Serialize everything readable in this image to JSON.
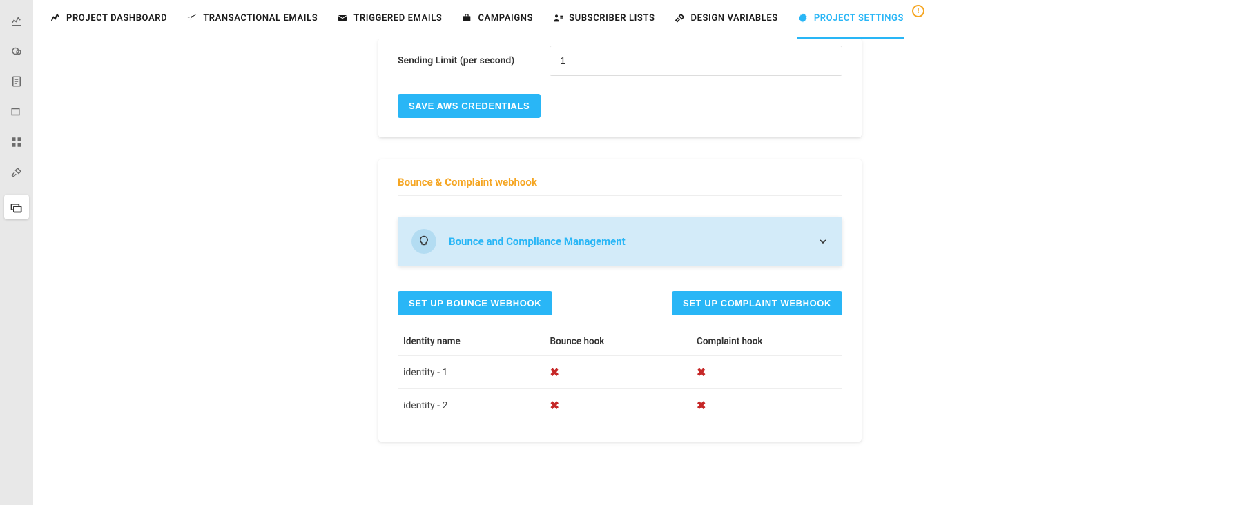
{
  "sidebar": {
    "items": [
      {
        "name": "analytics"
      },
      {
        "name": "cloud"
      },
      {
        "name": "document"
      },
      {
        "name": "layout"
      },
      {
        "name": "grid"
      },
      {
        "name": "tools"
      },
      {
        "name": "folders",
        "active": true
      }
    ]
  },
  "tabs": [
    {
      "label": "PROJECT DASHBOARD",
      "icon": "chart"
    },
    {
      "label": "TRANSACTIONAL EMAILS",
      "icon": "send"
    },
    {
      "label": "TRIGGERED EMAILS",
      "icon": "mail"
    },
    {
      "label": "CAMPAIGNS",
      "icon": "briefcase"
    },
    {
      "label": "SUBSCRIBER LISTS",
      "icon": "users"
    },
    {
      "label": "DESIGN VARIABLES",
      "icon": "wrench"
    },
    {
      "label": "PROJECT SETTINGS",
      "icon": "gear",
      "active": true,
      "alert": true
    }
  ],
  "card1": {
    "sending_limit_label": "Sending Limit (per second)",
    "sending_limit_value": "1",
    "save_btn": "SAVE AWS CREDENTIALS"
  },
  "card2": {
    "title": "Bounce & Complaint webhook",
    "banner_title": "Bounce and Compliance Management",
    "btn_bounce": "SET UP BOUNCE WEBHOOK",
    "btn_complaint": "SET UP COMPLAINT WEBHOOK",
    "table": {
      "headers": [
        "Identity name",
        "Bounce hook",
        "Complaint hook"
      ],
      "rows": [
        {
          "name": "identity - 1",
          "bounce": false,
          "complaint": false
        },
        {
          "name": "identity - 2",
          "bounce": false,
          "complaint": false
        }
      ]
    }
  }
}
